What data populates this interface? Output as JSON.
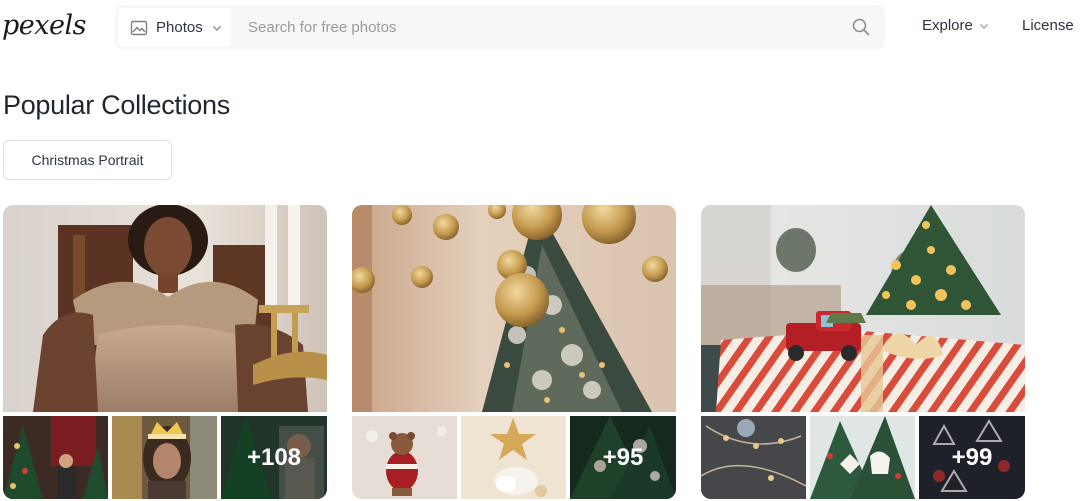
{
  "header": {
    "logo_text": "pexels",
    "search": {
      "type_label": "Photos",
      "placeholder": "Search for free photos"
    },
    "nav": {
      "explore_label": "Explore",
      "license_label": "License"
    }
  },
  "main": {
    "title": "Popular Collections",
    "filter_chip": "Christmas Portrait",
    "collections": [
      {
        "more_count": "+108"
      },
      {
        "more_count": "+95"
      },
      {
        "more_count": "+99"
      }
    ]
  },
  "colors": {
    "text": "#2c343e",
    "search_bg": "#f7f7f7",
    "chip_border": "#dfdfe0"
  },
  "icons": [
    "image-icon",
    "chevron-down-icon",
    "search-icon"
  ]
}
